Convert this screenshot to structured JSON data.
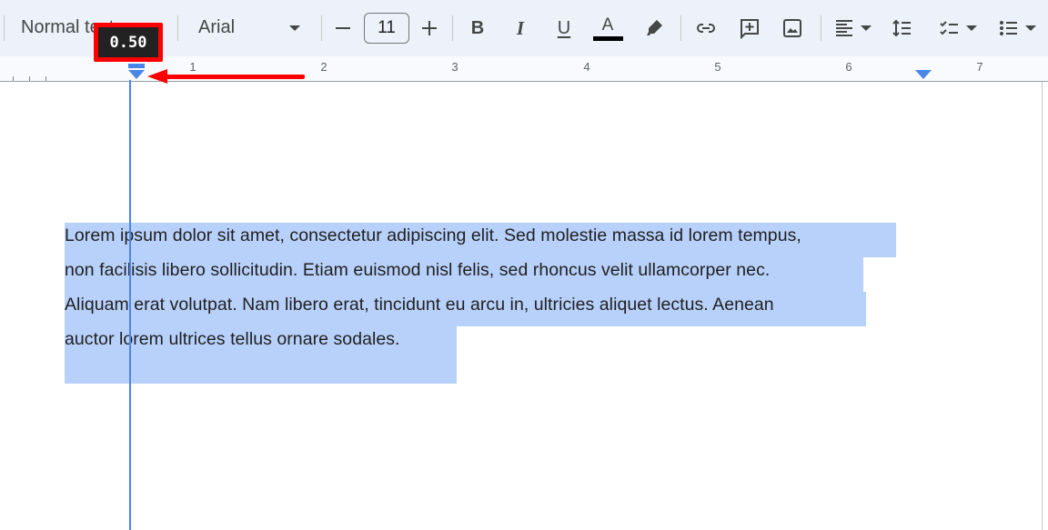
{
  "toolbar": {
    "paragraph_style": "Normal text",
    "font_family": "Arial",
    "font_size": "11",
    "decrease_size_icon": "minus-icon",
    "increase_size_icon": "plus-icon",
    "bold_glyph": "B",
    "italic_glyph": "I",
    "underline_glyph": "U",
    "text_color_glyph": "A",
    "text_color": "#000000",
    "icons": [
      "highlighter-icon",
      "link-icon",
      "add-comment-icon",
      "insert-image-icon",
      "align-left-icon",
      "line-spacing-icon",
      "checklist-icon",
      "bulleted-list-icon"
    ]
  },
  "ruler": {
    "numbers": [
      "1",
      "2",
      "3",
      "4",
      "5",
      "6",
      "7"
    ],
    "indent_tooltip": "0.50",
    "accent_color": "#4a86e8"
  },
  "annotation": {
    "highlight_color": "#ff0000",
    "arrow_direction": "left"
  },
  "document": {
    "selection_color": "#b8d1fb",
    "lines": [
      "Lorem ipsum dolor sit amet, consectetur adipiscing elit. Sed molestie massa id lorem tempus,",
      "non facilisis libero sollicitudin. Etiam euismod nisl felis, sed rhoncus velit ullamcorper nec.",
      "Aliquam erat volutpat. Nam libero erat, tincidunt eu arcu in, ultricies aliquet lectus. Aenean",
      "auctor lorem ultrices tellus ornare sodales."
    ]
  }
}
